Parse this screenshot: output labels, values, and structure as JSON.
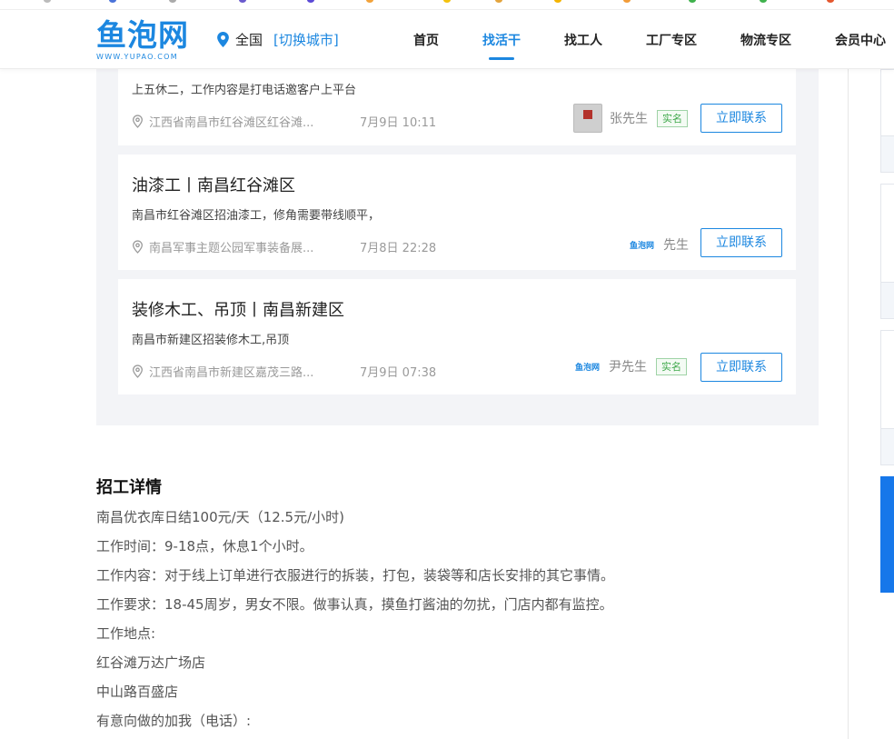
{
  "header": {
    "logo_main": "鱼泡网",
    "logo_sub": "WWW.YUPAO.COM",
    "location": "全国",
    "switch_city": "[切换城市]",
    "nav": [
      {
        "label": "首页",
        "active": false
      },
      {
        "label": "找活干",
        "active": true
      },
      {
        "label": "找工人",
        "active": false
      },
      {
        "label": "工厂专区",
        "active": false
      },
      {
        "label": "物流专区",
        "active": false
      },
      {
        "label": "会员中心",
        "active": false
      }
    ]
  },
  "cards": [
    {
      "title": "",
      "desc": "上五休二，工作内容是打电话邀客户上平台",
      "address": "江西省南昌市红谷滩区红谷滩...",
      "time": "7月9日 10:11",
      "poster_type": "avatar",
      "poster_name": "张先生",
      "verified": "实名",
      "button": "立即联系"
    },
    {
      "title": "油漆工丨南昌红谷滩区",
      "desc": "南昌市红谷滩区招油漆工，修角需要带线顺平，",
      "address": "南昌军事主题公园军事装备展...",
      "time": "7月8日 22:28",
      "poster_type": "logo",
      "poster_logo": "鱼泡网",
      "poster_name": "先生",
      "verified": "",
      "button": "立即联系"
    },
    {
      "title": "装修木工、吊顶丨南昌新建区",
      "desc": "南昌市新建区招装修木工,吊顶",
      "address": "江西省南昌市新建区嘉茂三路...",
      "time": "7月9日 07:38",
      "poster_type": "logo",
      "poster_logo": "鱼泡网",
      "poster_name": "尹先生",
      "verified": "实名",
      "button": "立即联系"
    }
  ],
  "details": {
    "title": "招工详情",
    "lines": [
      "南昌优衣库日结100元/天（12.5元/小时)",
      "工作时间：9-18点，休息1个小时。",
      "工作内容：对于线上订单进行衣服进行的拆装，打包，装袋等和店长安排的其它事情。",
      "工作要求：18-45周岁，男女不限。做事认真，摸鱼打酱油的勿扰，门店内都有监控。",
      "工作地点:",
      "红谷滩万达广场店",
      "中山路百盛店",
      "有意向做的加我（电话）:"
    ]
  },
  "colors": {
    "brand": "#1c87e0",
    "panel_bg": "#f3f4f7",
    "verified_green": "#3ea84a",
    "side_blue": "#1677ea"
  }
}
